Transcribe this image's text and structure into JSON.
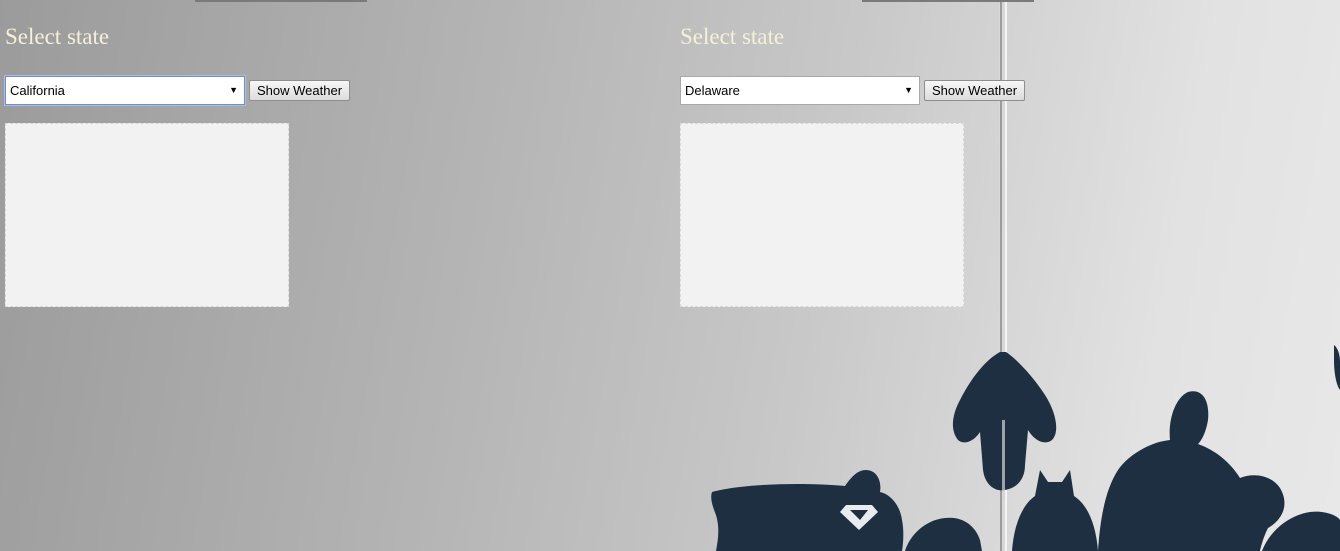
{
  "panels": [
    {
      "heading": "Select state",
      "selected_state": "California",
      "button_label": "Show Weather"
    },
    {
      "heading": "Select state",
      "selected_state": "Delaware",
      "button_label": "Show Weather"
    }
  ],
  "icons": {
    "dropdown": "triangle-down-icon"
  },
  "colors": {
    "heading_text": "#f5f0d6",
    "silhouette": "#1e2f42",
    "focus_border": "#6f8ecf"
  }
}
